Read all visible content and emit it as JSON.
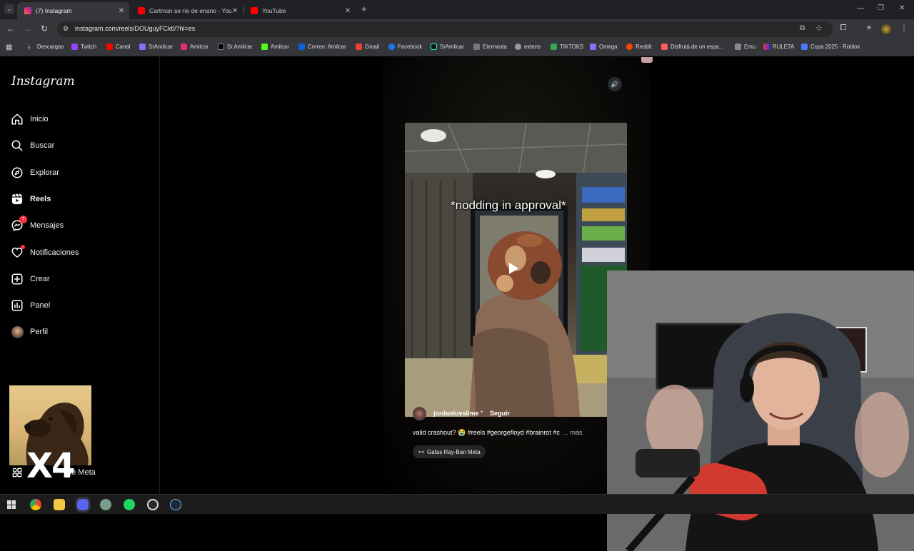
{
  "browser": {
    "tabs": [
      {
        "title": "(7) Instagram",
        "icon": "instagram-icon",
        "color": "#e1306c"
      },
      {
        "title": "Cartman se ríe de enano - YouTube",
        "icon": "youtube-icon",
        "color": "#ff0000"
      },
      {
        "title": "YouTube",
        "icon": "youtube-icon",
        "color": "#ff0000"
      }
    ],
    "url": "instagram.com/reels/DOUguyFCktl/?hl=es",
    "bookmarks": [
      {
        "label": "Descargas",
        "color": "#cccccc"
      },
      {
        "label": "Twitch",
        "color": "#9146ff"
      },
      {
        "label": "Canal",
        "color": "#ff0000"
      },
      {
        "label": "SrAmilcar",
        "color": "#8a6cff"
      },
      {
        "label": "Amilcar",
        "color": "#e1306c"
      },
      {
        "label": "Sr.Amilcar",
        "color": "#ffffff"
      },
      {
        "label": "Amilcar",
        "color": "#53fc18"
      },
      {
        "label": "Correo: Amilcar",
        "color": "#0a64d6"
      },
      {
        "label": "Gmail",
        "color": "#ea4335"
      },
      {
        "label": "Facebook",
        "color": "#1877f2"
      },
      {
        "label": "SrAmilcar",
        "color": "#25f4ee"
      },
      {
        "label": "Eternauta",
        "color": "#aaaaaa"
      },
      {
        "label": "extens",
        "color": "#cccccc"
      },
      {
        "label": "TIKTOKS",
        "color": "#34a853"
      },
      {
        "label": "Omega",
        "color": "#8a6cff"
      },
      {
        "label": "Reddit",
        "color": "#ff4500"
      },
      {
        "label": "Disfrutá de un espa...",
        "color": "#ff5a5f"
      },
      {
        "label": "Emu",
        "color": "#cccccc"
      },
      {
        "label": "RULETA",
        "color": "#ffffff"
      },
      {
        "label": "Copa 2025 - Roblox",
        "color": "#4a7bff"
      }
    ]
  },
  "instagram": {
    "logo": "Instagram",
    "nav": [
      {
        "label": "Inicio",
        "icon": "home-icon"
      },
      {
        "label": "Buscar",
        "icon": "search-icon"
      },
      {
        "label": "Explorar",
        "icon": "compass-icon"
      },
      {
        "label": "Reels",
        "icon": "reels-icon"
      },
      {
        "label": "Mensajes",
        "icon": "messenger-icon",
        "badge": "7"
      },
      {
        "label": "Notificaciones",
        "icon": "heart-icon"
      },
      {
        "label": "Crear",
        "icon": "plus-icon"
      },
      {
        "label": "Panel",
        "icon": "chart-icon"
      },
      {
        "label": "Perfil",
        "icon": "avatar-icon"
      }
    ],
    "more_label": "de Meta",
    "reel": {
      "caption_overlay": "*nodding in approval*",
      "username": "jordanluvslime",
      "follow": "Seguir",
      "description": "valid crashout? 😭 #reels #georgefloyd #brainrot #c",
      "more": "... más",
      "tag": "Gafas Ray-Ban Meta"
    }
  },
  "overlay": {
    "multiplier": "x4"
  }
}
